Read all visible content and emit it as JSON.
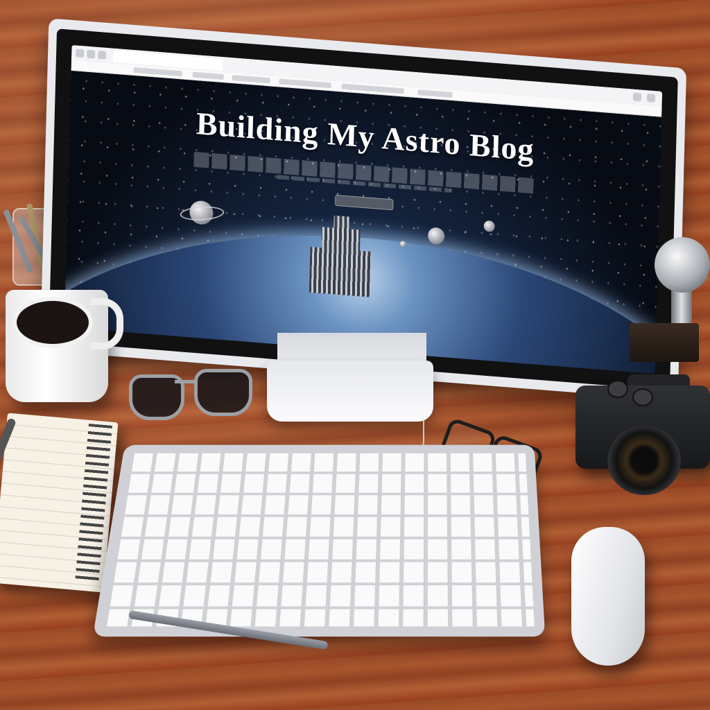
{
  "scene": {
    "description_visible_text_only": true
  },
  "browser": {
    "tab_title": "",
    "bookmarks": [
      "",
      "",
      "",
      "",
      "",
      ""
    ]
  },
  "page": {
    "hero_title": "Building My Astro Blog",
    "cta_label": ""
  },
  "colors": {
    "desk_wood": "#a8552d",
    "screen_space": "#070b14",
    "horizon_glow": "#6b93c2",
    "monitor_frame": "#e9eaee"
  },
  "icons": [
    "back-icon",
    "forward-icon",
    "reload-icon",
    "menu-icon"
  ]
}
